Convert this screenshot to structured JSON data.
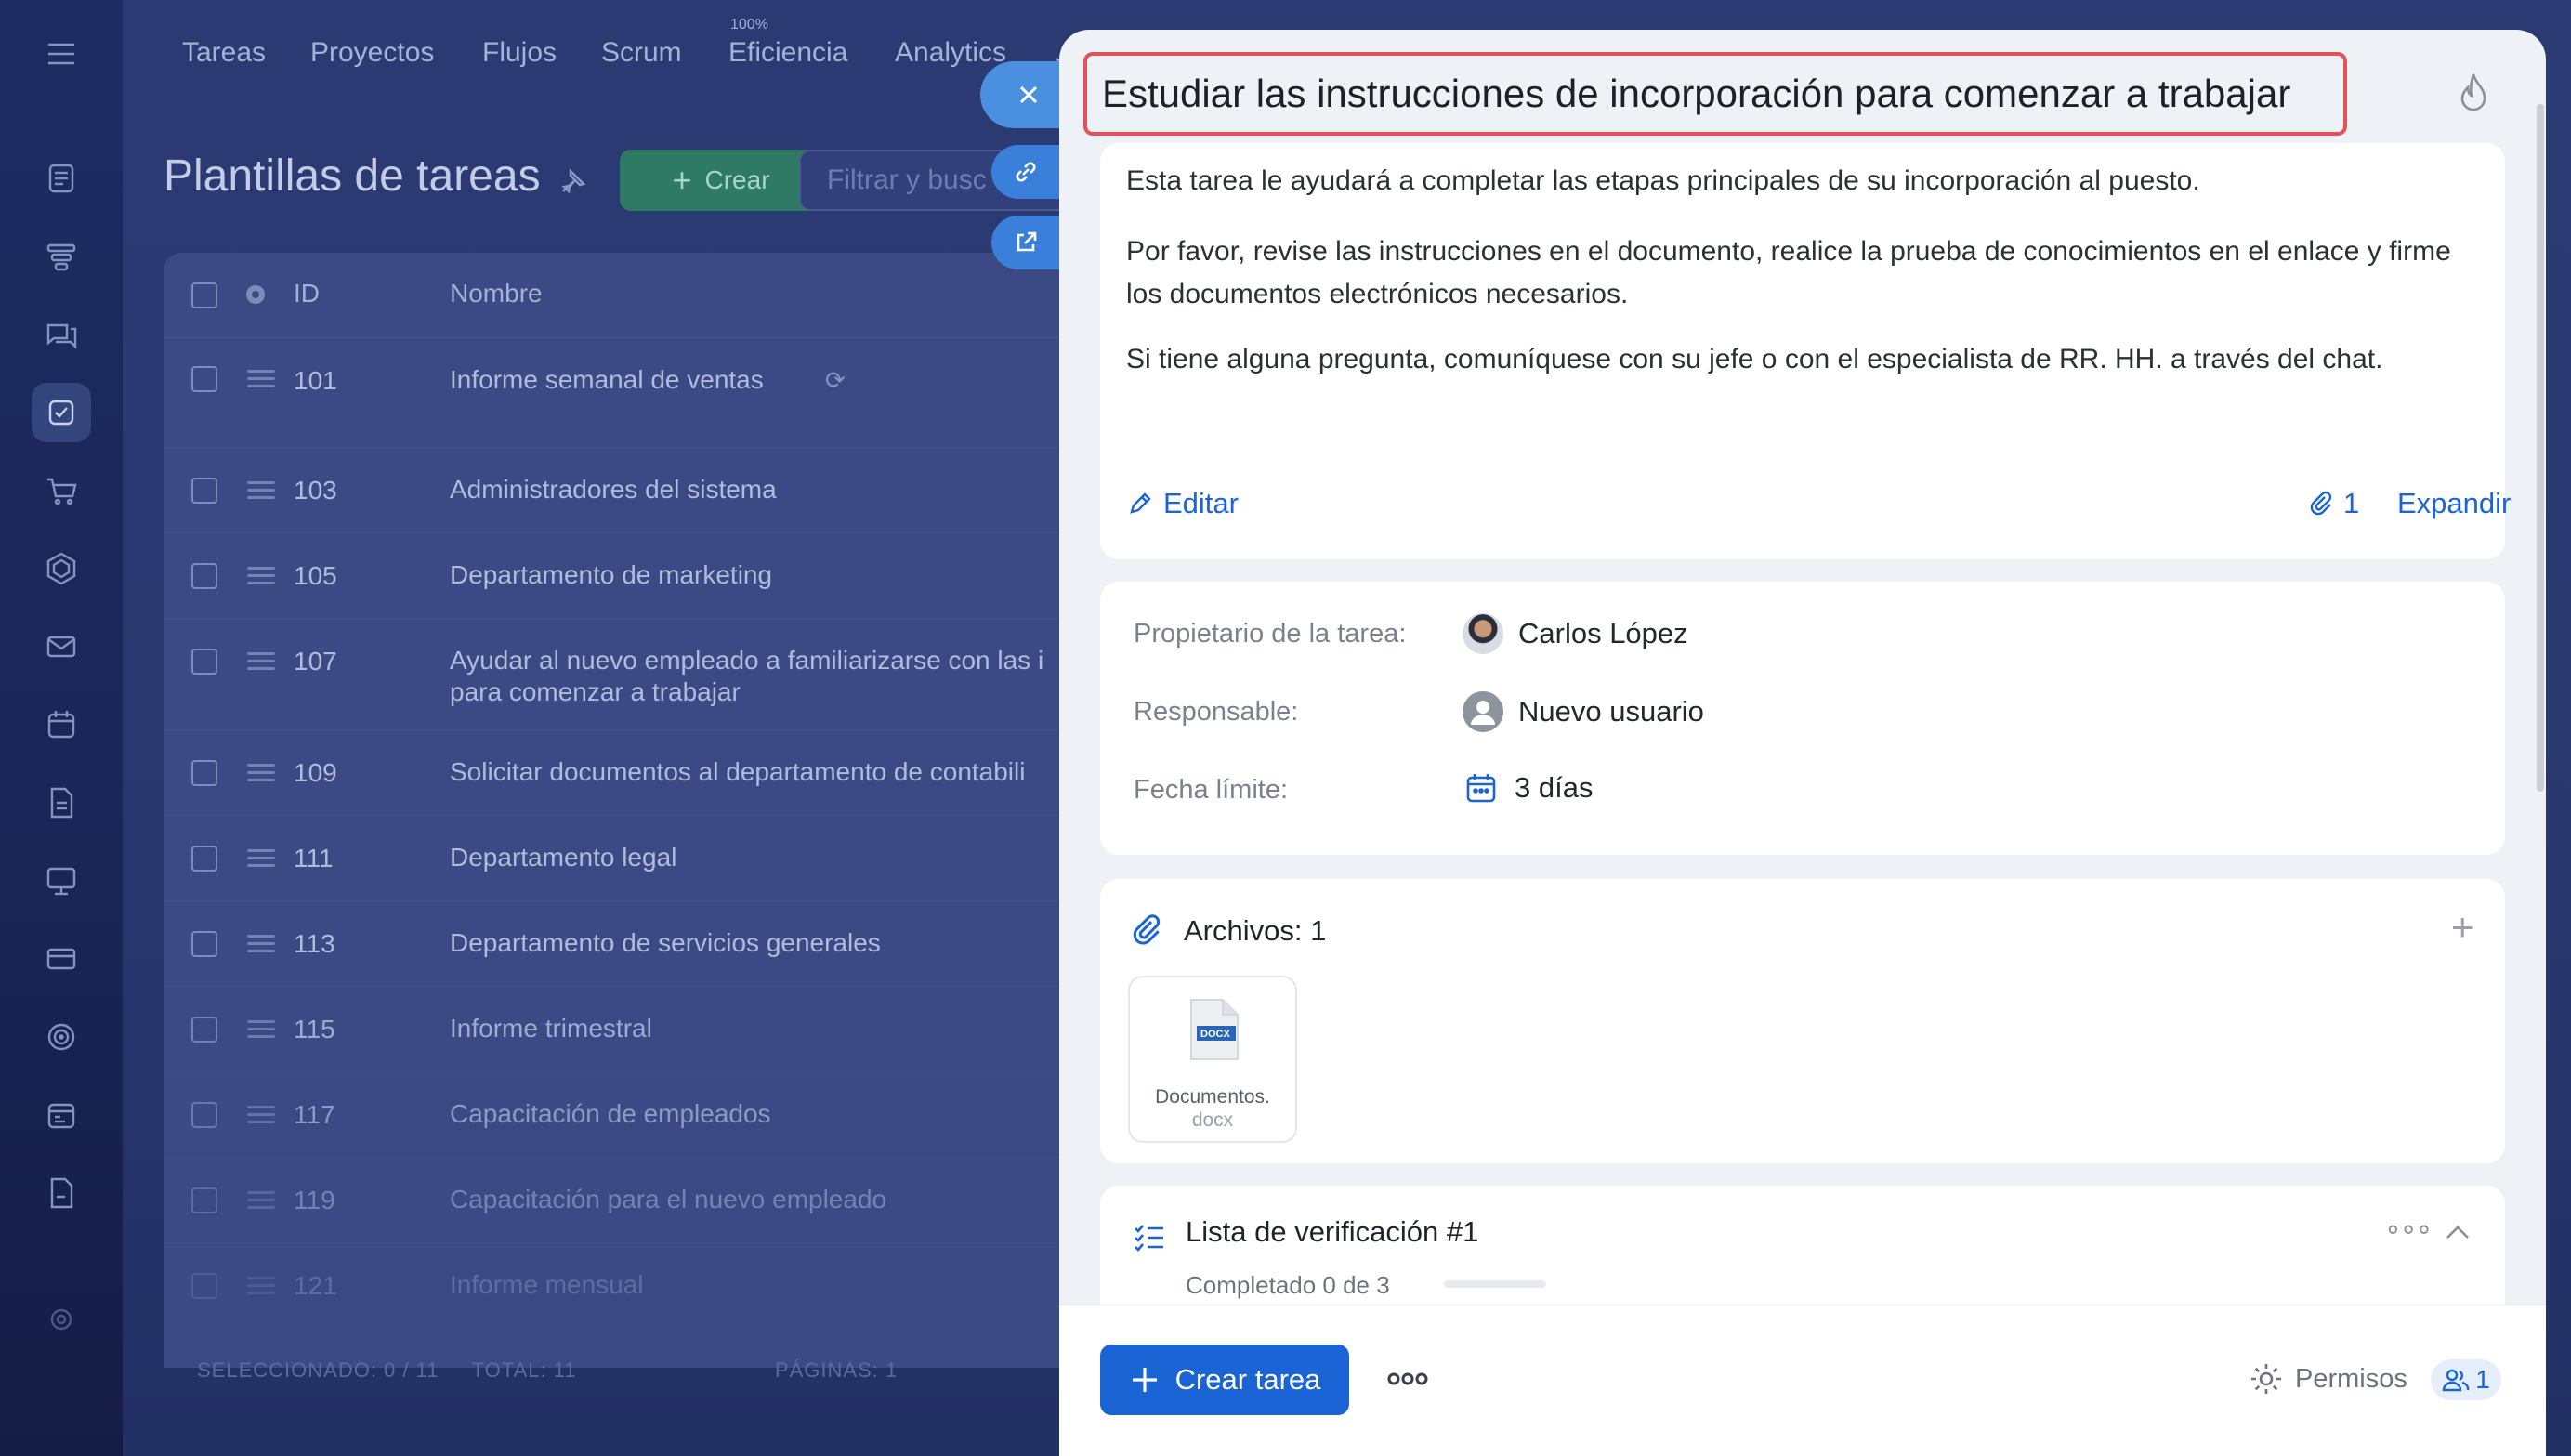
{
  "nav": {
    "items": [
      "Tareas",
      "Proyectos",
      "Flujos",
      "Scrum",
      "Eficiencia",
      "Analytics"
    ],
    "efficiency_badge": "100%"
  },
  "page": {
    "title": "Plantillas de tareas",
    "create_label": "Crear",
    "filter_placeholder": "Filtrar y busc"
  },
  "table": {
    "headers": {
      "id": "ID",
      "name": "Nombre"
    },
    "rows": [
      {
        "id": "101",
        "name": "Informe semanal de ventas"
      },
      {
        "id": "103",
        "name": "Administradores del sistema"
      },
      {
        "id": "105",
        "name": "Departamento de marketing"
      },
      {
        "id": "107",
        "name": "Ayudar al nuevo empleado a familiarizarse con las i",
        "name2": "para comenzar a trabajar"
      },
      {
        "id": "109",
        "name": "Solicitar documentos al departamento de contabili"
      },
      {
        "id": "111",
        "name": "Departamento legal"
      },
      {
        "id": "113",
        "name": "Departamento de servicios generales"
      },
      {
        "id": "115",
        "name": "Informe trimestral"
      },
      {
        "id": "117",
        "name": "Capacitación de empleados"
      },
      {
        "id": "119",
        "name": "Capacitación para el nuevo empleado"
      },
      {
        "id": "121",
        "name": "Informe mensual"
      }
    ],
    "footer": "SELECCIONADO: 0 / 11     TOTAL: 11                              PÁGINAS: 1"
  },
  "task": {
    "title": "Estudiar las instrucciones de incorporación para comenzar a trabajar",
    "description": [
      "Esta tarea le ayudará a completar las etapas principales de su incorporación al puesto.",
      "Por favor, revise las instrucciones en el documento, realice la prueba de conocimientos en el enlace y firme los documentos electrónicos necesarios.",
      "Si tiene alguna pregunta, comuníquese con su jefe o con el especialista de RR. HH. a través del chat."
    ],
    "edit_label": "Editar",
    "attachments_count": "1",
    "expand_label": "Expandir",
    "props": {
      "owner_label": "Propietario de la tarea:",
      "owner_value": "Carlos López",
      "responsible_label": "Responsable:",
      "responsible_value": "Nuevo usuario",
      "deadline_label": "Fecha límite:",
      "deadline_value": "3 días"
    },
    "files": {
      "title": "Archivos: 1",
      "file_name": "Documentos.",
      "file_ext": "docx",
      "file_icon_text": "DOCX"
    },
    "checklist": {
      "title": "Lista de verificación #1",
      "progress_text": "Completado 0 de 3",
      "progress_fraction": 0
    },
    "create_task_label": "Crear tarea",
    "permissions_label": "Permisos",
    "members_count": "1"
  },
  "colors": {
    "accent": "#1a64d6",
    "highlight_border": "#e2525a",
    "sidebar_bg": "#1e2c62"
  }
}
